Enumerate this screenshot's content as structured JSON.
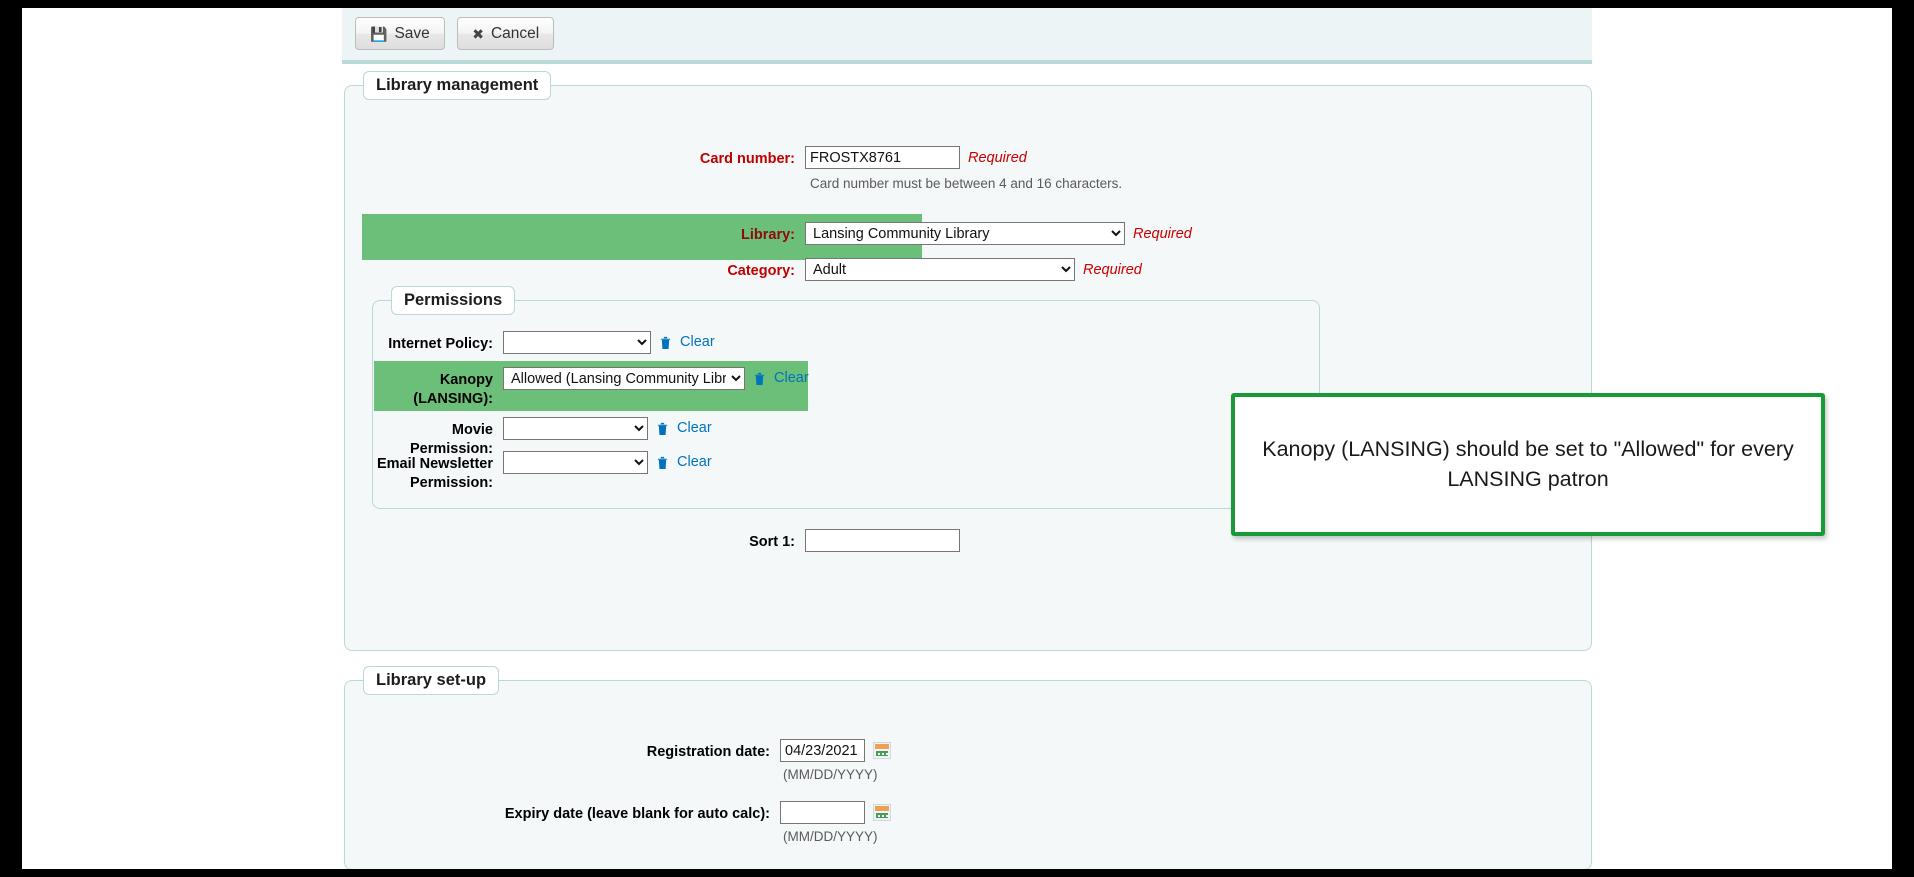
{
  "toolbar": {
    "save_label": "Save",
    "save_icon": "floppy-disk-icon",
    "cancel_label": "Cancel",
    "cancel_icon": "times-icon"
  },
  "library_management": {
    "legend": "Library management",
    "card_number": {
      "label": "Card number:",
      "value": "FROSTX8761",
      "required_note": "Required",
      "hint": "Card number must be between 4 and 16 characters."
    },
    "library": {
      "label": "Library:",
      "value": "Lansing Community Library",
      "required_note": "Required",
      "highlighted": true
    },
    "category": {
      "label": "Category:",
      "value": "Adult",
      "required_note": "Required"
    },
    "permissions": {
      "legend": "Permissions",
      "clear_label": "Clear",
      "trash_icon": "trash-icon",
      "rows": [
        {
          "label": "Internet Policy:",
          "value": "",
          "highlighted": false
        },
        {
          "label": "Kanopy (LANSING):",
          "value": "Allowed (Lansing Community Library)",
          "highlighted": true
        },
        {
          "label": "Movie Permission:",
          "value": "",
          "highlighted": false
        },
        {
          "label": "Email Newsletter Permission:",
          "value": "",
          "highlighted": false
        }
      ]
    },
    "sort1": {
      "label": "Sort 1:",
      "value": ""
    }
  },
  "library_setup": {
    "legend": "Library set-up",
    "registration_date": {
      "label": "Registration date:",
      "value": "04/23/2021",
      "format_hint": "(MM/DD/YYYY)",
      "calendar_icon": "calendar-icon"
    },
    "expiry_date": {
      "label": "Expiry date (leave blank for auto calc):",
      "value": "",
      "format_hint": "(MM/DD/YYYY)",
      "calendar_icon": "calendar-icon"
    }
  },
  "annotation": {
    "text": "Kanopy (LANSING) should be set to \"Allowed\" for every LANSING patron",
    "border_color": "#199a38"
  },
  "colors": {
    "highlight_green": "#6cbf78",
    "required_red": "#cc0000",
    "link_blue": "#0073bd",
    "panel_bg": "#f4f8f9",
    "panel_border": "#b9d8d9"
  }
}
